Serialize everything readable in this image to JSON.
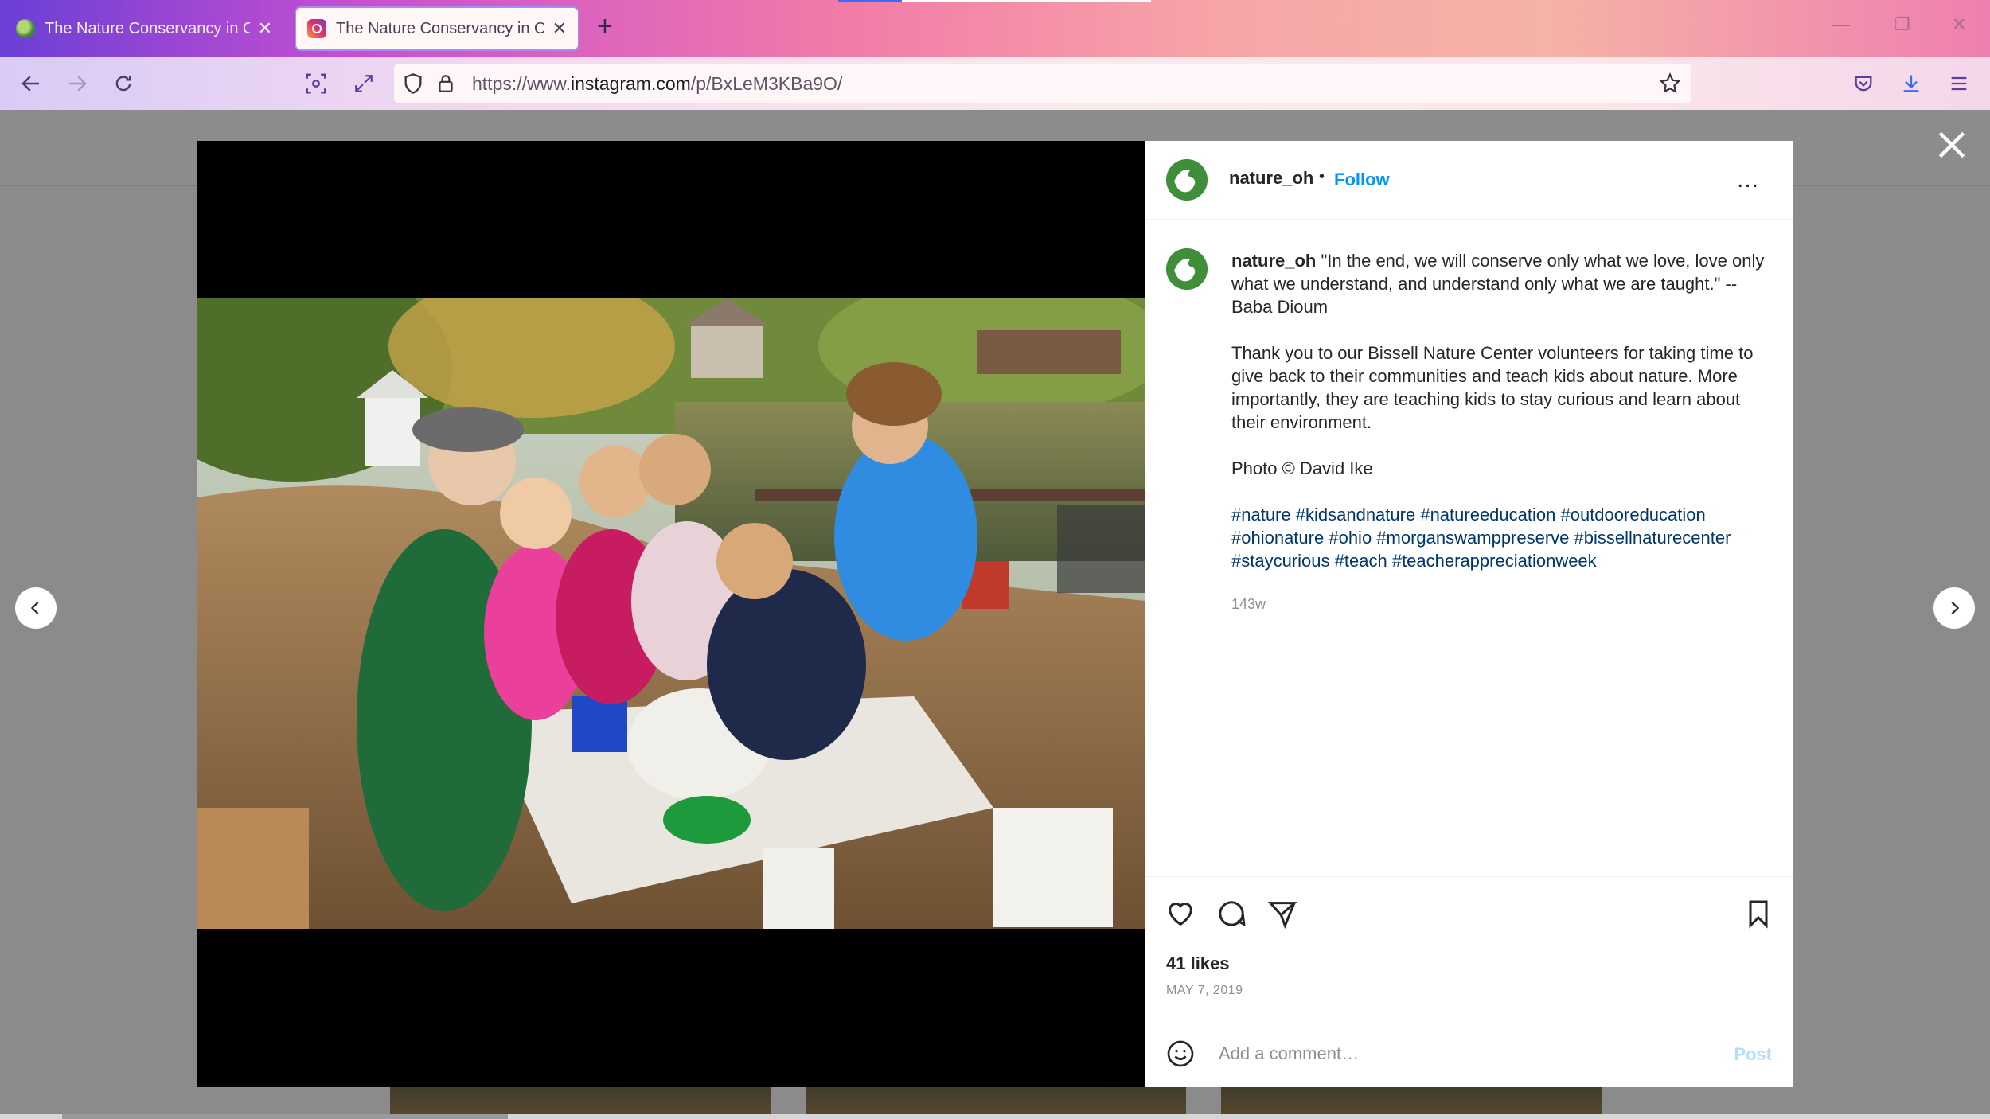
{
  "browser": {
    "tabs": [
      {
        "title": "The Nature Conservancy in Ohio",
        "active": false
      },
      {
        "title": "The Nature Conservancy in OH",
        "active": true
      }
    ],
    "new_tab_icon": "plus-icon",
    "url_prefix": "https://www.",
    "url_domain": "instagram.com",
    "url_path": "/p/BxLeM3KBa9O/"
  },
  "post": {
    "username": "nature_oh",
    "separator": "•",
    "follow_label": "Follow",
    "more_label": "...",
    "caption_username": "nature_oh",
    "caption_quote": "\"In the end, we will conserve only what we love, love only what we understand, and understand only what we are taught.\" -- Baba Dioum",
    "caption_body": "Thank you to our Bissell Nature Center volunteers for taking time to give back to their communities and teach kids about nature. More importantly, they are teaching kids to stay curious and learn about their environment.",
    "caption_credit": "Photo © David Ike",
    "hashtags": [
      "#nature",
      "#kidsandnature",
      "#natureeducation",
      "#outdooreducation",
      "#ohionature",
      "#ohio",
      "#morganswamppreserve",
      "#bissellnaturecenter",
      "#staycurious",
      "#teach",
      "#teacherappreciationweek"
    ],
    "age": "143w",
    "likes": "41 likes",
    "date": "MAY 7, 2019",
    "comment_placeholder": "Add a comment…",
    "post_label": "Post"
  },
  "colors": {
    "link_blue": "#0095f6",
    "hashtag_blue": "#00376b",
    "post_disabled": "#b2dffc",
    "avatar_green": "#3f8f3a"
  }
}
